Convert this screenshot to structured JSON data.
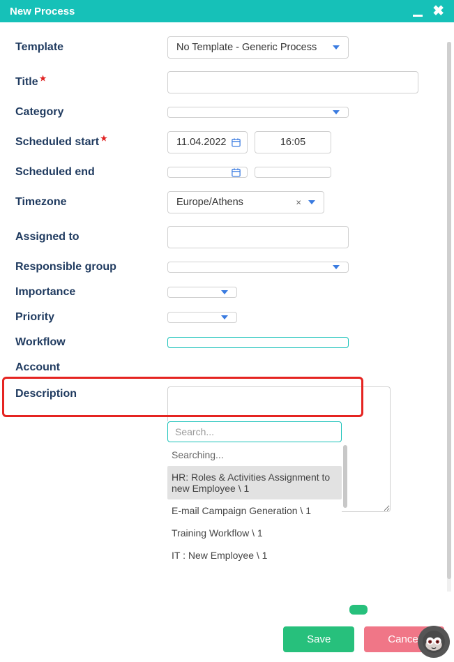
{
  "titlebar": {
    "title": "New Process"
  },
  "labels": {
    "template": "Template",
    "title": "Title",
    "category": "Category",
    "scheduled_start": "Scheduled start",
    "scheduled_end": "Scheduled end",
    "timezone": "Timezone",
    "assigned_to": "Assigned to",
    "responsible_group": "Responsible group",
    "importance": "Importance",
    "priority": "Priority",
    "workflow": "Workflow",
    "account": "Account",
    "description": "Description"
  },
  "values": {
    "template": "No Template - Generic Process",
    "title": "",
    "category": "",
    "scheduled_start_date": "11.04.2022",
    "scheduled_start_time": "16:05",
    "scheduled_end_date": "",
    "scheduled_end_time": "",
    "timezone": "Europe/Athens",
    "assigned_to": "",
    "responsible_group": "",
    "importance": "",
    "priority": "",
    "workflow": "",
    "account": "",
    "description": ""
  },
  "dropdown": {
    "search_placeholder": "Search...",
    "status": "Searching...",
    "items": [
      "HR: Roles & Activities Assignment to new Employee \\ 1",
      "E-mail Campaign Generation \\ 1",
      "Training Workflow \\ 1",
      "IT : New Employee \\ 1"
    ]
  },
  "buttons": {
    "save": "Save",
    "cancel": "Cancel"
  }
}
